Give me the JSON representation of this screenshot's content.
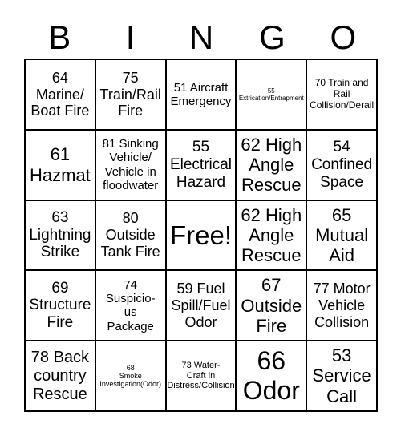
{
  "header": [
    "B",
    "I",
    "N",
    "G",
    "O"
  ],
  "cells": [
    "64\nMarine/\nBoat Fire",
    "75\nTrain/Rail\nFire",
    "51 Aircraft\nEmergency",
    "55\nExtrication/Entrapment",
    "70 Train and\nRail\nCollision/Derail",
    "61\nHazmat",
    "81 Sinking\nVehicle/\nVehicle in\nfloodwater",
    "55\nElectrical\nHazard",
    "62 High\nAngle\nRescue",
    "54\nConfined\nSpace",
    "63\nLightning\nStrike",
    "80\nOutside\nTank Fire",
    "Free!",
    "62 High\nAngle\nRescue",
    "65\nMutual\nAid",
    "69\nStructure\nFire",
    "74\nSuspicio-\nus\nPackage",
    "59 Fuel\nSpill/Fuel\nOdor",
    "67\nOutside\nFire",
    "77 Motor\nVehicle\nCollision",
    "78 Back\ncountry\nRescue",
    "68\nSmoke\nInvestigation(Odor)",
    "73 Water-\nCraft in\nDistress/Collision",
    "66\nOdor",
    "53\nService\nCall"
  ]
}
